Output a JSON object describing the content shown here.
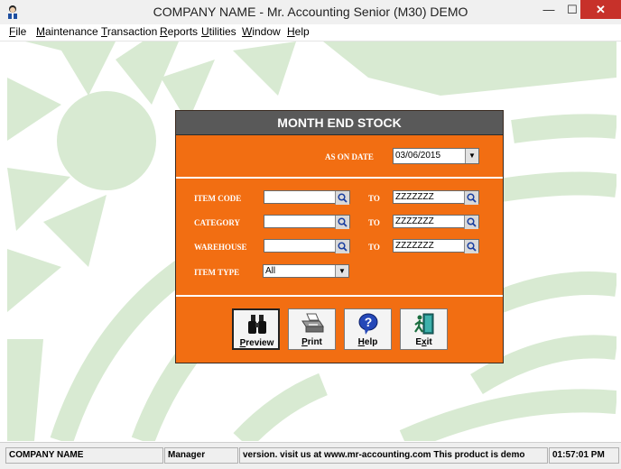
{
  "window": {
    "title": "COMPANY NAME - Mr. Accounting Senior (M30) DEMO",
    "minimize_glyph": "—",
    "maximize_glyph": "☐",
    "close_glyph": "✕"
  },
  "menu": {
    "items": [
      {
        "accel": "F",
        "rest": "ile"
      },
      {
        "accel": "M",
        "rest": "aintenance"
      },
      {
        "accel": "T",
        "rest": "ransaction"
      },
      {
        "accel": "R",
        "rest": "eports"
      },
      {
        "accel": "U",
        "rest": "tilities"
      },
      {
        "accel": "W",
        "rest": "indow"
      },
      {
        "accel": "H",
        "rest": "elp"
      }
    ]
  },
  "dialog": {
    "title": "MONTH END STOCK",
    "as_on_date_label": "AS ON DATE",
    "as_on_date_value": "03/06/2015",
    "to_label": "TO",
    "item_code": {
      "label": "ITEM CODE",
      "from": "",
      "to": "ZZZZZZZ"
    },
    "category": {
      "label": "CATEGORY",
      "from": "",
      "to": "ZZZZZZZ"
    },
    "warehouse": {
      "label": "WAREHOUSE",
      "from": "",
      "to": "ZZZZZZZ"
    },
    "item_type": {
      "label": "ITEM TYPE",
      "value": "All"
    },
    "buttons": {
      "preview": {
        "accel": "P",
        "rest": "review",
        "icon": "binoculars-icon"
      },
      "print": {
        "accel": "P",
        "rest": "rint",
        "icon": "printer-icon"
      },
      "help": {
        "accel": "H",
        "rest": "elp",
        "icon": "help-icon"
      },
      "exit": {
        "before": "E",
        "accel": "x",
        "rest": "it",
        "icon": "exit-icon"
      }
    }
  },
  "status": {
    "company": "COMPANY NAME",
    "user": "Manager",
    "message": "version.  visit us at www.mr-accounting.com This product is demo",
    "time": "01:57:01 PM"
  },
  "colors": {
    "dialog_bg": "#f26e12",
    "dialog_title_bg": "#595959",
    "background_art": "#d8ead2",
    "close_button": "#c7312a"
  }
}
